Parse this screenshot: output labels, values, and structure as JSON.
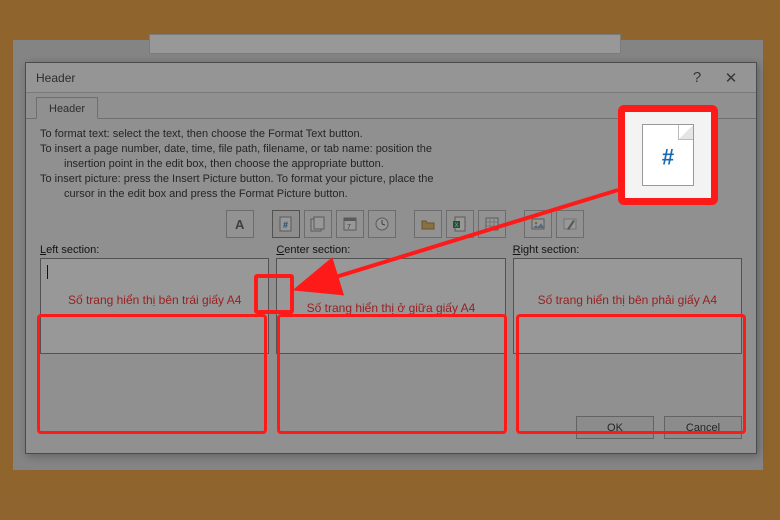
{
  "dialog": {
    "title": "Header",
    "tab_label": "Header",
    "instructions": {
      "l1": "To format text:  select the text, then choose the Format Text button.",
      "l2": "To insert a page number, date, time, file path, filename, or tab name:  position the",
      "l2b": "insertion point in the edit box, then choose the appropriate button.",
      "l3": "To insert picture: press the Insert Picture button.  To format your picture, place the",
      "l3b": "cursor in the edit box and press the Format Picture button."
    },
    "toolbar": {
      "format_text": "A",
      "page_number": "#",
      "pages": "pages",
      "date": "date",
      "time": "time",
      "file_path": "filepath",
      "file_name": "filename",
      "sheet_name": "sheetname",
      "insert_picture": "picture",
      "format_picture": "formatpic"
    },
    "sections": {
      "left": {
        "label_prefix": "L",
        "label_rest": "eft section:"
      },
      "center": {
        "label_prefix": "C",
        "label_rest": "enter section:"
      },
      "right": {
        "label_prefix": "R",
        "label_rest": "ight section:"
      }
    },
    "buttons": {
      "ok": "OK",
      "cancel": "Cancel"
    }
  },
  "annotations": {
    "left": "Số trang hiển thị bên trái giấy A4",
    "center": "Số trang hiển thị ở giữa giấy A4",
    "right": "Số trang hiển thị bên phải giấy A4"
  }
}
